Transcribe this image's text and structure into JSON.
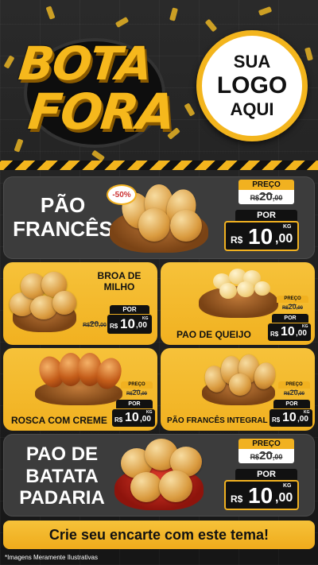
{
  "header": {
    "title_line1": "BOTA",
    "title_line2": "FORA",
    "logo_line1": "SUA",
    "logo_line2": "LOGO",
    "logo_line3": "AQUI",
    "accent_color": "#f1b120"
  },
  "discount_badge": "-50%",
  "products": [
    {
      "name": "PÃO FRANCÊS",
      "name_lines": [
        "PÃO",
        "FRANCÊS"
      ],
      "preco_label": "PREÇO",
      "old_price": "R$ 20,00",
      "old_int": "20",
      "old_dec": ",00",
      "por_label": "POR",
      "currency": "R$",
      "price_int": "10",
      "price_dec": ",00",
      "unit": "KG"
    },
    {
      "name": "BROA DE MILHO",
      "name_lines": [
        "BROA DE",
        "MILHO"
      ],
      "old_price": "R$ 20,00",
      "old_int": "20",
      "old_dec": ",00",
      "por_label": "POR",
      "currency": "R$",
      "price_int": "10",
      "price_dec": ",00",
      "unit": "KG"
    },
    {
      "name": "PAO DE QUEIJO",
      "preco_label": "PREÇO",
      "old_price": "R$ 20,00",
      "old_int": "20",
      "old_dec": ",00",
      "por_label": "POR",
      "currency": "R$",
      "price_int": "10",
      "price_dec": ",00",
      "unit": "KG"
    },
    {
      "name": "ROSCA COM CREME",
      "preco_label": "PREÇO",
      "old_price": "R$ 20,00",
      "old_int": "20",
      "old_dec": ",00",
      "por_label": "POR",
      "currency": "R$",
      "price_int": "10",
      "price_dec": ",00",
      "unit": "KG"
    },
    {
      "name": "PÃO FRANCÊS INTEGRAL",
      "preco_label": "PREÇO",
      "old_price": "R$ 20,00",
      "old_int": "20",
      "old_dec": ",00",
      "por_label": "POR",
      "currency": "R$",
      "price_int": "10",
      "price_dec": ",00",
      "unit": "KG"
    },
    {
      "name": "PAO DE BATATA PADARIA",
      "name_lines": [
        "PAO DE",
        "BATATA",
        "PADARIA"
      ],
      "preco_label": "PREÇO",
      "old_price": "R$ 20,00",
      "old_int": "20",
      "old_dec": ",00",
      "por_label": "POR",
      "currency": "R$",
      "price_int": "10",
      "price_dec": ",00",
      "unit": "KG"
    }
  ],
  "cta": "Crie seu encarte com este tema!",
  "footnote": "*Imagens Meramente Ilustrativas"
}
